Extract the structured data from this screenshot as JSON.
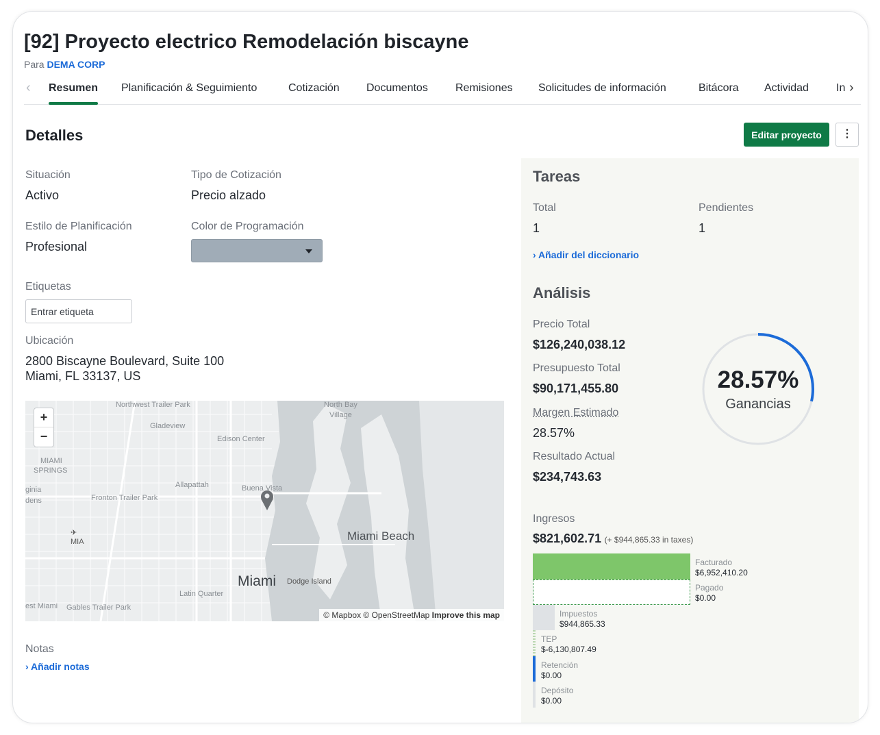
{
  "header": {
    "title": "[92] Proyecto electrico Remodelación biscayne",
    "for_prefix": "Para",
    "client": "DEMA CORP"
  },
  "tabs": [
    {
      "label": "Resumen",
      "active": true
    },
    {
      "label": "Planificación & Seguimiento"
    },
    {
      "label": "Cotización"
    },
    {
      "label": "Documentos"
    },
    {
      "label": "Remisiones"
    },
    {
      "label": "Solicitudes de información"
    },
    {
      "label": "Bitácora"
    },
    {
      "label": "Actividad"
    },
    {
      "label": "In"
    }
  ],
  "details": {
    "heading": "Detalles",
    "edit_button": "Editar proyecto",
    "more_button": "⋮",
    "status_label": "Situación",
    "status_value": "Activo",
    "quote_type_label": "Tipo de Cotización",
    "quote_type_value": "Precio alzado",
    "planning_style_label": "Estilo de Planificación",
    "planning_style_value": "Profesional",
    "schedule_color_label": "Color de Programación",
    "schedule_color": "#a0acb7",
    "tags_label": "Etiquetas",
    "tags_placeholder": "Entrar etiqueta",
    "location_label": "Ubicación",
    "address_line1": "2800 Biscayne Boulevard, Suite 100",
    "address_line2": "Miami, FL 33137, US",
    "notes_label": "Notas",
    "add_notes": "Añadir notas"
  },
  "map": {
    "labels": {
      "northwest": "Northwest Trailer Park",
      "north_bay": "North Bay",
      "village": "Village",
      "gladeview": "Gladeview",
      "edison": "Edison Center",
      "miami_springs_1": "MIAMI",
      "miami_springs_2": "SPRINGS",
      "allapattah": "Allapattah",
      "buena_vista": "Buena Vista",
      "virginia": "ginia",
      "gardens": "dens",
      "fronton": "Fronton Trailer Park",
      "miami_beach": "Miami Beach",
      "mia": "MIA",
      "miami": "Miami",
      "dodge": "Dodge Island",
      "latin_quarter": "Latin Quarter",
      "west_miami": "est Miami",
      "gables": "Gables Trailer Park"
    },
    "zoom_in": "+",
    "zoom_out": "−",
    "attribution": "© Mapbox © OpenStreetMap",
    "improve": "Improve this map"
  },
  "tasks": {
    "heading": "Tareas",
    "total_label": "Total",
    "total_value": "1",
    "pending_label": "Pendientes",
    "pending_value": "1",
    "add_link": "Añadir del diccionario"
  },
  "analysis": {
    "heading": "Análisis",
    "total_price_label": "Precio Total",
    "total_price_value": "$126,240,038.12",
    "total_budget_label": "Presupuesto Total",
    "total_budget_value": "$90,171,455.80",
    "margin_label": "Margen Estimado",
    "margin_value": "28.57%",
    "actual_label": "Resultado Actual",
    "actual_value": "$234,743.63",
    "gauge_pct": "28.57%",
    "gauge_label": "Ganancias",
    "gauge_fraction": 0.2857
  },
  "income": {
    "label": "Ingresos",
    "value": "$821,602.71",
    "taxes_note": "(+ $944,865.33 in taxes)",
    "rows": [
      {
        "label": "Facturado",
        "value": "$6,952,410.20"
      },
      {
        "label": "Pagado",
        "value": "$0.00"
      },
      {
        "label": "Impuestos",
        "value": "$944,865.33"
      },
      {
        "label": "TEP",
        "value": "$-6,130,807.49"
      },
      {
        "label": "Retención",
        "value": "$0.00"
      },
      {
        "label": "Depósito",
        "value": "$0.00"
      }
    ],
    "colors": {
      "invoiced": "#7ec66a",
      "paid_border": "#3f9a4e",
      "taxes": "#dfe2e5",
      "tep": "#b9d7b0",
      "retention": "#1c6bd8",
      "deposit": "#dfe2e5"
    }
  }
}
